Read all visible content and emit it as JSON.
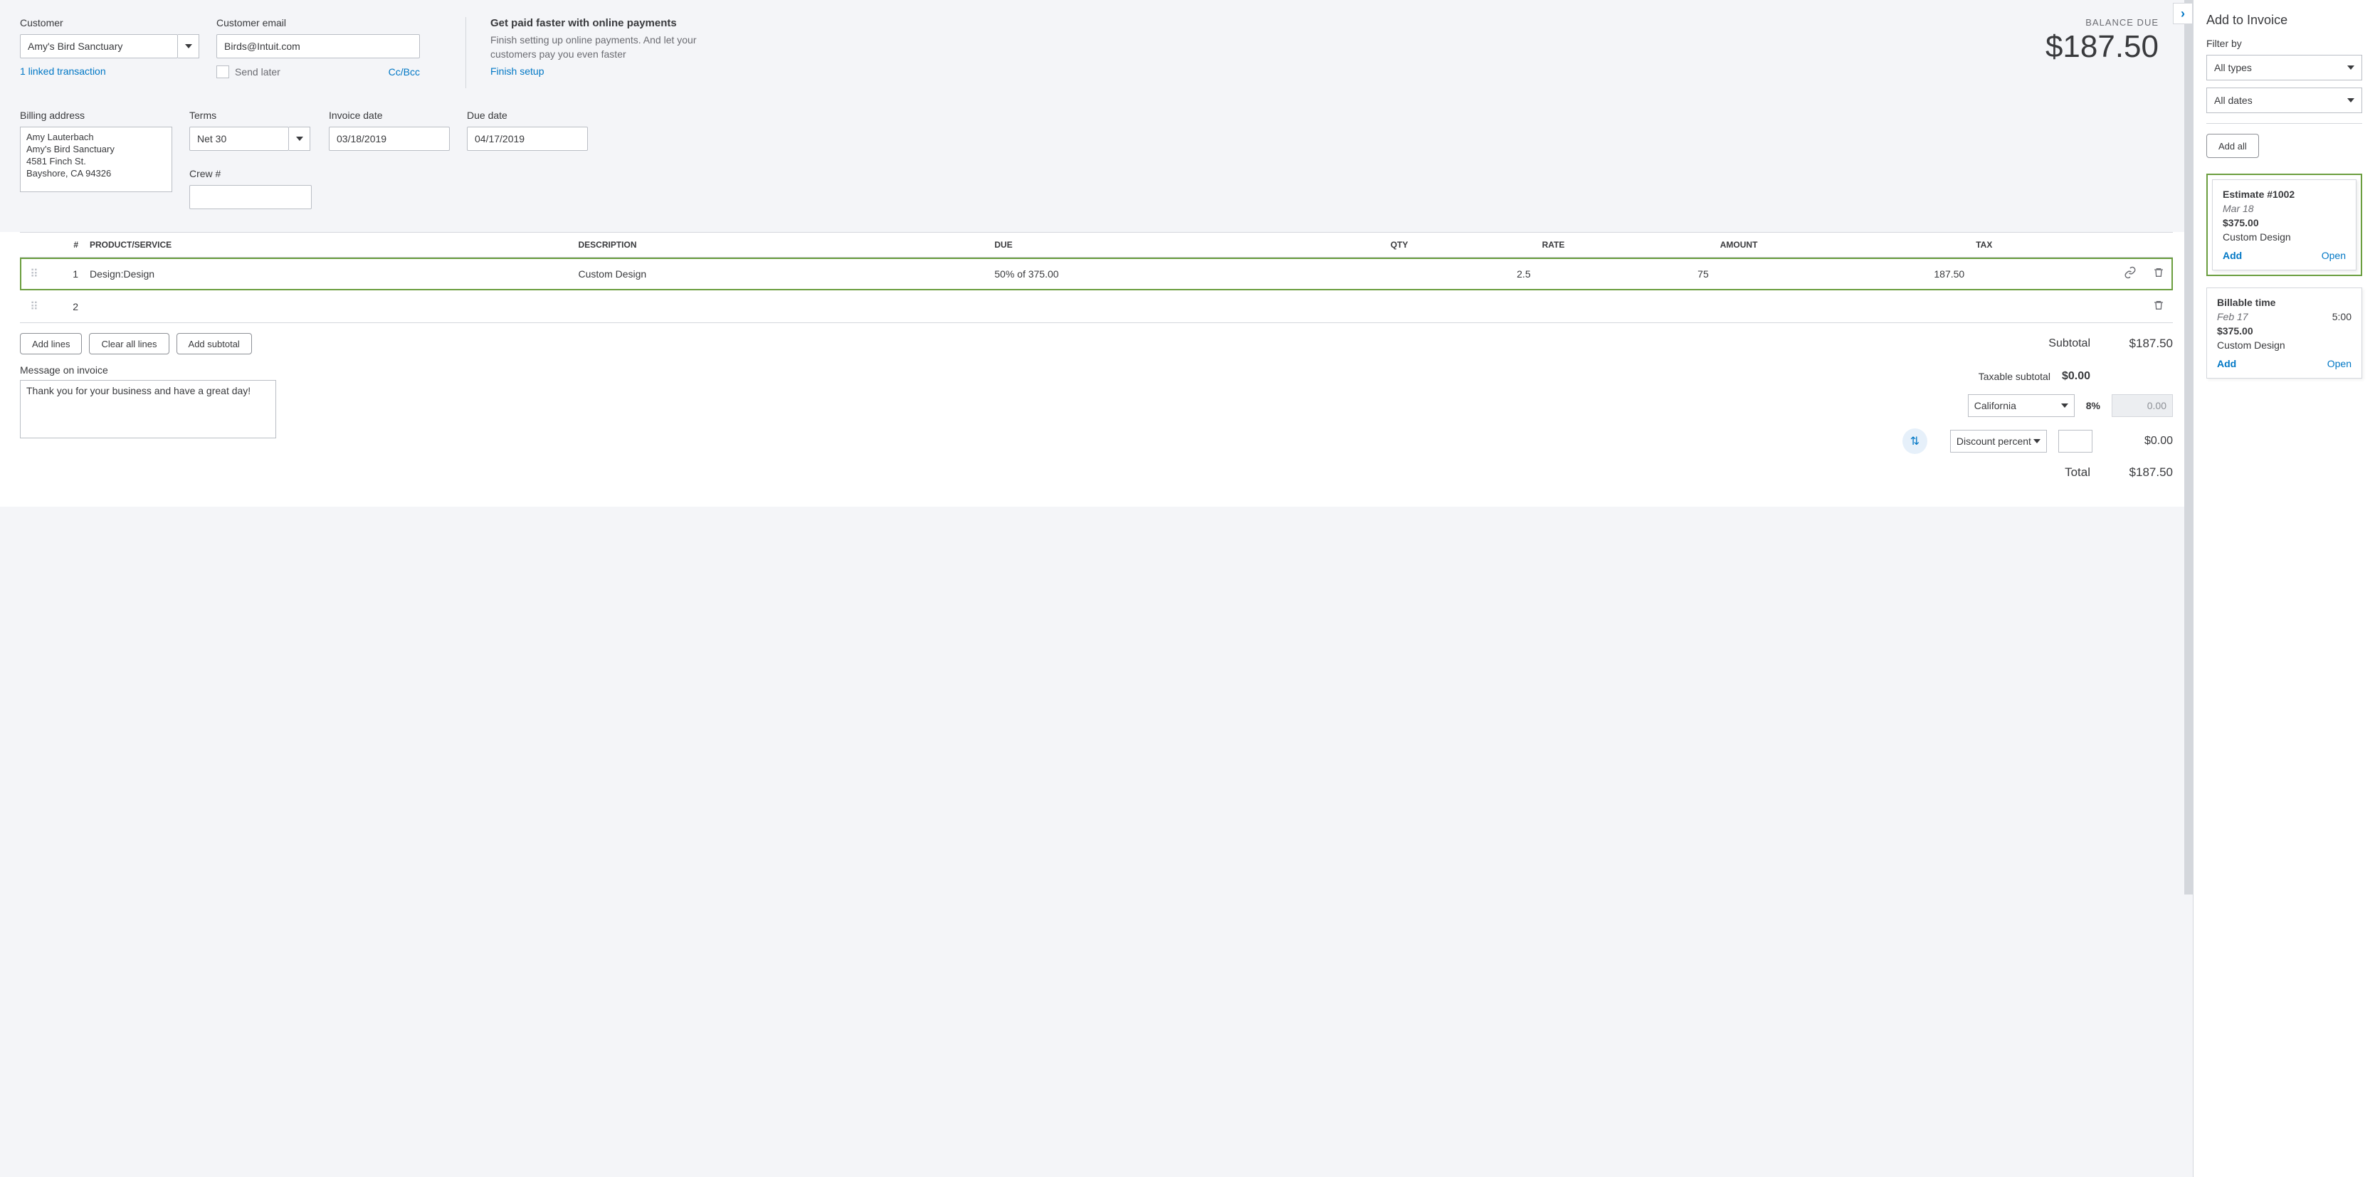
{
  "customer": {
    "label": "Customer",
    "value": "Amy's Bird Sanctuary",
    "linked_text": "1 linked transaction"
  },
  "email": {
    "label": "Customer email",
    "value": "Birds@Intuit.com",
    "send_later_label": "Send later",
    "cc_bcc": "Cc/Bcc"
  },
  "promo": {
    "title": "Get paid faster with online payments",
    "body": "Finish setting up online payments. And let your customers pay you even faster",
    "link": "Finish setup"
  },
  "balance": {
    "label": "BALANCE DUE",
    "amount": "$187.50"
  },
  "billing": {
    "label": "Billing address",
    "lines": "Amy Lauterbach\nAmy's Bird Sanctuary\n4581 Finch St.\nBayshore, CA  94326"
  },
  "terms": {
    "label": "Terms",
    "value": "Net 30"
  },
  "invoice_date": {
    "label": "Invoice date",
    "value": "03/18/2019"
  },
  "due_date": {
    "label": "Due date",
    "value": "04/17/2019"
  },
  "crew": {
    "label": "Crew #",
    "value": ""
  },
  "columns": {
    "num": "#",
    "product": "PRODUCT/SERVICE",
    "desc": "DESCRIPTION",
    "due": "DUE",
    "qty": "QTY",
    "rate": "RATE",
    "amount": "AMOUNT",
    "tax": "TAX"
  },
  "lines": [
    {
      "n": "1",
      "product": "Design:Design",
      "desc": "Custom Design",
      "due": "50% of 375.00",
      "qty": "2.5",
      "rate": "75",
      "amount": "187.50"
    },
    {
      "n": "2",
      "product": "",
      "desc": "",
      "due": "",
      "qty": "",
      "rate": "",
      "amount": ""
    }
  ],
  "line_buttons": {
    "add_lines": "Add lines",
    "clear": "Clear all lines",
    "subtotal": "Add subtotal"
  },
  "message": {
    "label": "Message on invoice",
    "value": "Thank you for your business and have a great day!"
  },
  "totals": {
    "subtotal_label": "Subtotal",
    "subtotal": "$187.50",
    "taxable_label": "Taxable subtotal",
    "taxable": "$0.00",
    "tax_region": "California",
    "tax_pct": "8%",
    "tax_amount": "0.00",
    "discount_label": "Discount percent",
    "discount_amount": "$0.00",
    "total_label": "Total",
    "total": "$187.50"
  },
  "panel": {
    "title": "Add to Invoice",
    "filter_label": "Filter by",
    "filter_type": "All types",
    "filter_date": "All dates",
    "add_all": "Add all",
    "cards": [
      {
        "title": "Estimate #1002",
        "date": "Mar 18",
        "time": "",
        "amount": "$375.00",
        "desc": "Custom Design",
        "add": "Add",
        "open": "Open"
      },
      {
        "title": "Billable time",
        "date": "Feb 17",
        "time": "5:00",
        "amount": "$375.00",
        "desc": "Custom Design",
        "add": "Add",
        "open": "Open"
      }
    ]
  }
}
